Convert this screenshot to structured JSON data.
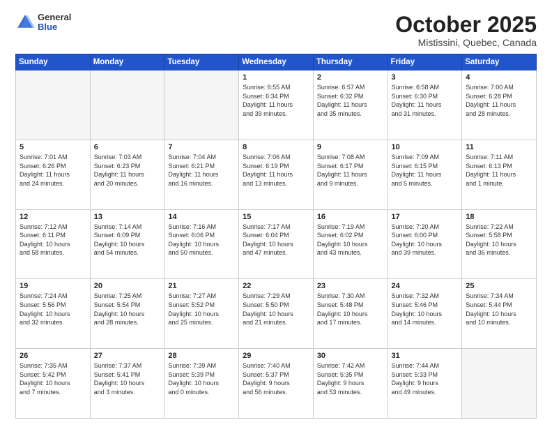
{
  "header": {
    "logo": {
      "general": "General",
      "blue": "Blue"
    },
    "title": "October 2025",
    "subtitle": "Mistissini, Quebec, Canada"
  },
  "calendar": {
    "days_of_week": [
      "Sunday",
      "Monday",
      "Tuesday",
      "Wednesday",
      "Thursday",
      "Friday",
      "Saturday"
    ],
    "weeks": [
      [
        {
          "day": "",
          "info": ""
        },
        {
          "day": "",
          "info": ""
        },
        {
          "day": "",
          "info": ""
        },
        {
          "day": "1",
          "info": "Sunrise: 6:55 AM\nSunset: 6:34 PM\nDaylight: 11 hours\nand 39 minutes."
        },
        {
          "day": "2",
          "info": "Sunrise: 6:57 AM\nSunset: 6:32 PM\nDaylight: 11 hours\nand 35 minutes."
        },
        {
          "day": "3",
          "info": "Sunrise: 6:58 AM\nSunset: 6:30 PM\nDaylight: 11 hours\nand 31 minutes."
        },
        {
          "day": "4",
          "info": "Sunrise: 7:00 AM\nSunset: 6:28 PM\nDaylight: 11 hours\nand 28 minutes."
        }
      ],
      [
        {
          "day": "5",
          "info": "Sunrise: 7:01 AM\nSunset: 6:26 PM\nDaylight: 11 hours\nand 24 minutes."
        },
        {
          "day": "6",
          "info": "Sunrise: 7:03 AM\nSunset: 6:23 PM\nDaylight: 11 hours\nand 20 minutes."
        },
        {
          "day": "7",
          "info": "Sunrise: 7:04 AM\nSunset: 6:21 PM\nDaylight: 11 hours\nand 16 minutes."
        },
        {
          "day": "8",
          "info": "Sunrise: 7:06 AM\nSunset: 6:19 PM\nDaylight: 11 hours\nand 13 minutes."
        },
        {
          "day": "9",
          "info": "Sunrise: 7:08 AM\nSunset: 6:17 PM\nDaylight: 11 hours\nand 9 minutes."
        },
        {
          "day": "10",
          "info": "Sunrise: 7:09 AM\nSunset: 6:15 PM\nDaylight: 11 hours\nand 5 minutes."
        },
        {
          "day": "11",
          "info": "Sunrise: 7:11 AM\nSunset: 6:13 PM\nDaylight: 11 hours\nand 1 minute."
        }
      ],
      [
        {
          "day": "12",
          "info": "Sunrise: 7:12 AM\nSunset: 6:11 PM\nDaylight: 10 hours\nand 58 minutes."
        },
        {
          "day": "13",
          "info": "Sunrise: 7:14 AM\nSunset: 6:09 PM\nDaylight: 10 hours\nand 54 minutes."
        },
        {
          "day": "14",
          "info": "Sunrise: 7:16 AM\nSunset: 6:06 PM\nDaylight: 10 hours\nand 50 minutes."
        },
        {
          "day": "15",
          "info": "Sunrise: 7:17 AM\nSunset: 6:04 PM\nDaylight: 10 hours\nand 47 minutes."
        },
        {
          "day": "16",
          "info": "Sunrise: 7:19 AM\nSunset: 6:02 PM\nDaylight: 10 hours\nand 43 minutes."
        },
        {
          "day": "17",
          "info": "Sunrise: 7:20 AM\nSunset: 6:00 PM\nDaylight: 10 hours\nand 39 minutes."
        },
        {
          "day": "18",
          "info": "Sunrise: 7:22 AM\nSunset: 5:58 PM\nDaylight: 10 hours\nand 36 minutes."
        }
      ],
      [
        {
          "day": "19",
          "info": "Sunrise: 7:24 AM\nSunset: 5:56 PM\nDaylight: 10 hours\nand 32 minutes."
        },
        {
          "day": "20",
          "info": "Sunrise: 7:25 AM\nSunset: 5:54 PM\nDaylight: 10 hours\nand 28 minutes."
        },
        {
          "day": "21",
          "info": "Sunrise: 7:27 AM\nSunset: 5:52 PM\nDaylight: 10 hours\nand 25 minutes."
        },
        {
          "day": "22",
          "info": "Sunrise: 7:29 AM\nSunset: 5:50 PM\nDaylight: 10 hours\nand 21 minutes."
        },
        {
          "day": "23",
          "info": "Sunrise: 7:30 AM\nSunset: 5:48 PM\nDaylight: 10 hours\nand 17 minutes."
        },
        {
          "day": "24",
          "info": "Sunrise: 7:32 AM\nSunset: 5:46 PM\nDaylight: 10 hours\nand 14 minutes."
        },
        {
          "day": "25",
          "info": "Sunrise: 7:34 AM\nSunset: 5:44 PM\nDaylight: 10 hours\nand 10 minutes."
        }
      ],
      [
        {
          "day": "26",
          "info": "Sunrise: 7:35 AM\nSunset: 5:42 PM\nDaylight: 10 hours\nand 7 minutes."
        },
        {
          "day": "27",
          "info": "Sunrise: 7:37 AM\nSunset: 5:41 PM\nDaylight: 10 hours\nand 3 minutes."
        },
        {
          "day": "28",
          "info": "Sunrise: 7:39 AM\nSunset: 5:39 PM\nDaylight: 10 hours\nand 0 minutes."
        },
        {
          "day": "29",
          "info": "Sunrise: 7:40 AM\nSunset: 5:37 PM\nDaylight: 9 hours\nand 56 minutes."
        },
        {
          "day": "30",
          "info": "Sunrise: 7:42 AM\nSunset: 5:35 PM\nDaylight: 9 hours\nand 53 minutes."
        },
        {
          "day": "31",
          "info": "Sunrise: 7:44 AM\nSunset: 5:33 PM\nDaylight: 9 hours\nand 49 minutes."
        },
        {
          "day": "",
          "info": ""
        }
      ]
    ]
  }
}
